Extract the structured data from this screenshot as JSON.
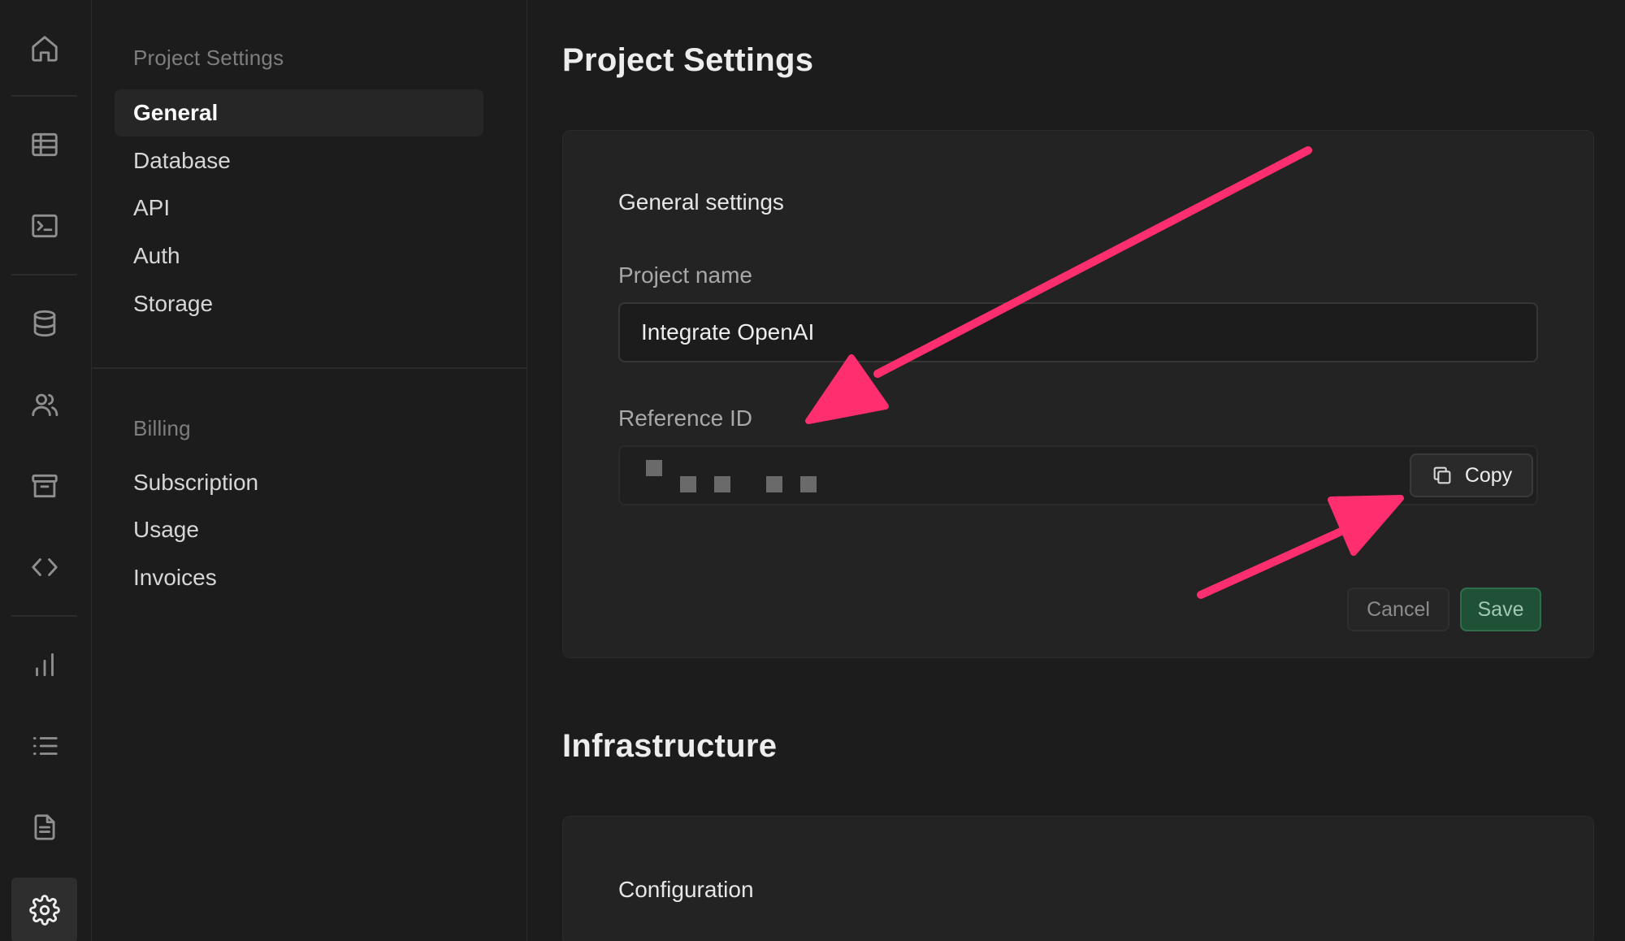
{
  "sidebar": {
    "section1_heading": "Project Settings",
    "section1_items": [
      "General",
      "Database",
      "API",
      "Auth",
      "Storage"
    ],
    "section2_heading": "Billing",
    "section2_items": [
      "Subscription",
      "Usage",
      "Invoices"
    ]
  },
  "main": {
    "page_title": "Project Settings",
    "general_card": {
      "title": "General settings",
      "project_name_label": "Project name",
      "project_name_value": "Integrate OpenAI",
      "reference_id_label": "Reference ID",
      "copy_label": "Copy",
      "cancel_label": "Cancel",
      "save_label": "Save"
    },
    "infrastructure_title": "Infrastructure",
    "config_card": {
      "title": "Configuration"
    }
  },
  "icons": {
    "rail": [
      "home-icon",
      "table-editor-icon",
      "sql-editor-icon",
      "database-icon",
      "users-icon",
      "storage-icon",
      "api-code-icon",
      "reports-icon",
      "logs-icon",
      "docs-icon",
      "settings-icon"
    ],
    "copy": "copy-icon"
  },
  "colors": {
    "annotation_arrow": "#ff2e6e",
    "save_button": "#1e5136",
    "background": "#1c1c1c"
  }
}
